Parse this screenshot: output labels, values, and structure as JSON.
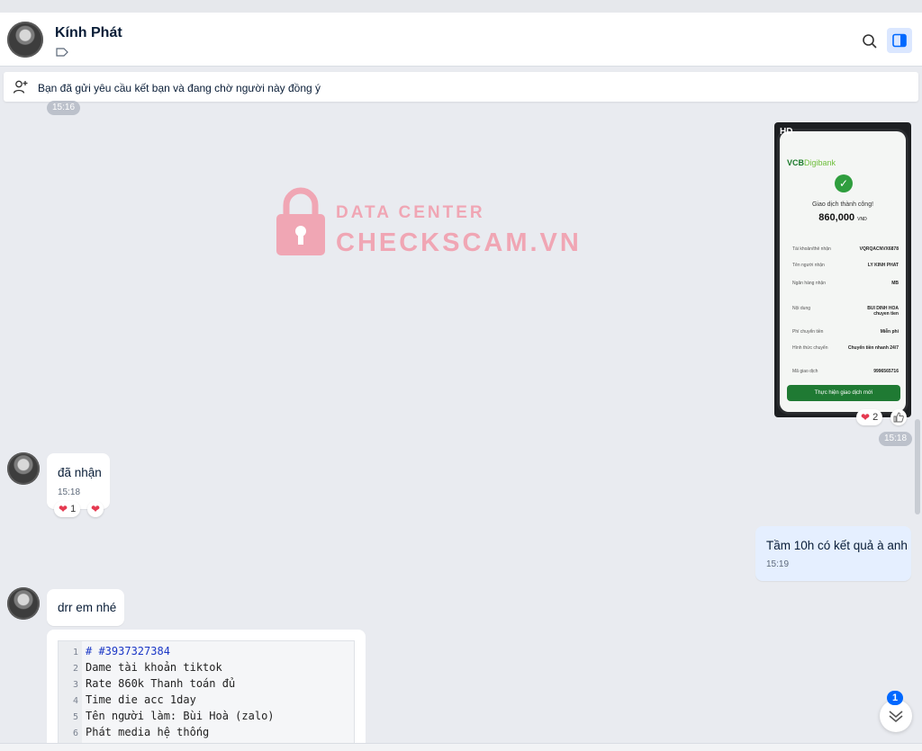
{
  "header": {
    "contact_name": "Kính Phát",
    "icons": [
      "avatar",
      "tag-icon",
      "search-icon",
      "side-panel-icon"
    ]
  },
  "friend_request": {
    "text": "Bạn đã gửi yêu cầu kết bạn và đang chờ người này đồng ý",
    "icon": "user-add-icon"
  },
  "watermark": {
    "line1": "DATA CENTER",
    "line2": "CHECKSCAM.VN",
    "color": "#f0a6b4"
  },
  "messages": {
    "top_time": "15:16",
    "photo": {
      "badge": "HD",
      "bank_logo": "VCB",
      "bank_logo_suffix": "Digibank",
      "status": "Giao dịch thành công!",
      "amount": "860,000",
      "amount_unit": "VND",
      "rows": [
        {
          "label": "Tài khoản/thẻ nhận",
          "value": "VQRQACNVX6878"
        },
        {
          "label": "Tên người nhận",
          "value": "LY KINH PHAT"
        },
        {
          "label": "Ngân hàng nhận",
          "value": "MB"
        },
        {
          "label": "Nội dung",
          "value": "BUI DINH HOA chuyen tien"
        },
        {
          "label": "Phí chuyển tiền",
          "value": "Miễn phí"
        },
        {
          "label": "Hình thức chuyển",
          "value": "Chuyển tiền nhanh 24/7"
        },
        {
          "label": "Mã giao dịch",
          "value": "9996565716"
        }
      ],
      "button": "Thực hiện giao dịch mới",
      "reaction_count": "2",
      "time": "15:18"
    },
    "received_1": {
      "text": "đã nhận",
      "time": "15:18",
      "reaction_count": "1"
    },
    "sent_1": {
      "text": "Tầm 10h có kết quả à anh",
      "time": "15:19"
    },
    "received_2": {
      "text": "drr em nhé"
    },
    "code_lines": [
      {
        "n": "1",
        "text": "# #3937327384"
      },
      {
        "n": "2",
        "text": "Dame tài khoản tiktok"
      },
      {
        "n": "3",
        "text": "Rate 860k Thanh toán đủ"
      },
      {
        "n": "4",
        "text": "Time die acc 1day"
      },
      {
        "n": "5",
        "text": "Tên người làm: Bùi Hoà (zalo)"
      },
      {
        "n": "6",
        "text": "Phát media hệ thống"
      }
    ]
  },
  "scroll_down": {
    "unread": "1"
  },
  "colors": {
    "accent": "#0068ff",
    "heart": "#e53950",
    "mine_bubble": "#e5efff",
    "bg": "#e9ebf0"
  }
}
